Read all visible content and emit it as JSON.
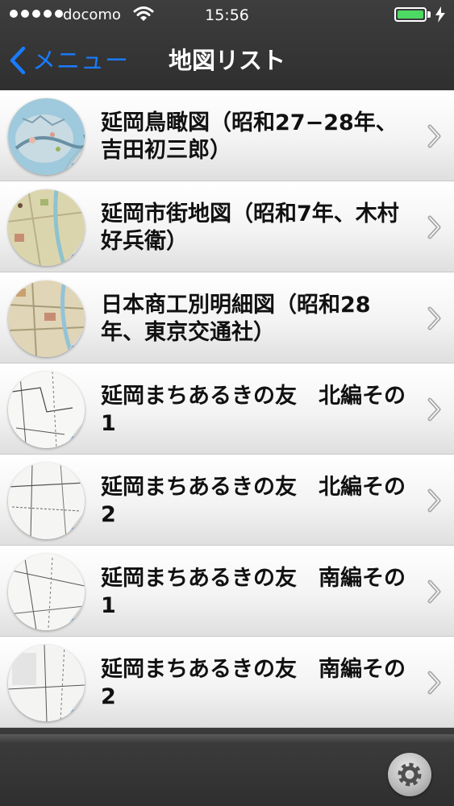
{
  "status_bar": {
    "carrier": "docomo",
    "time": "15:56",
    "signal_bars": 5,
    "battery_level": 1.0,
    "battery_color": "#4cd964",
    "icons": [
      "wifi-icon",
      "battery-icon",
      "charging-bolt-icon"
    ]
  },
  "nav": {
    "back_label": "メニュー",
    "back_icon": "chevron-left-icon",
    "title": "地図リスト",
    "accent_color": "#1a7bff"
  },
  "map_list": {
    "items": [
      {
        "label": "延岡鳥瞰図（昭和27−28年、吉田初三郎）",
        "thumb_icon": "bird-eye-map-thumbnail-icon"
      },
      {
        "label": "延岡市街地図（昭和7年、木村好兵衛）",
        "thumb_icon": "city-map-thumbnail-icon"
      },
      {
        "label": "日本商工別明細図（昭和28年、東京交通社）",
        "thumb_icon": "detailed-map-thumbnail-icon"
      },
      {
        "label": "延岡まちあるきの友　北編その1",
        "thumb_icon": "walking-map-thumbnail-icon"
      },
      {
        "label": "延岡まちあるきの友　北編その2",
        "thumb_icon": "walking-map-thumbnail-icon"
      },
      {
        "label": "延岡まちあるきの友　南編その1",
        "thumb_icon": "walking-map-thumbnail-icon"
      },
      {
        "label": "延岡まちあるきの友　南編その2",
        "thumb_icon": "walking-map-thumbnail-icon"
      }
    ],
    "row_icon": "chevron-right-icon"
  },
  "toolbar": {
    "settings_icon": "gear-icon"
  }
}
